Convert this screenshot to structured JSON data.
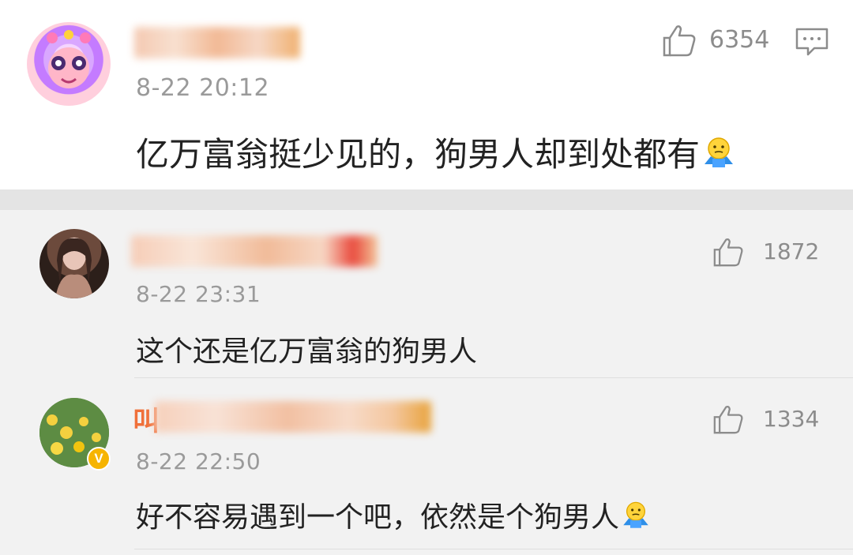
{
  "comments": [
    {
      "timestamp": "8-22 20:12",
      "likes": "6354",
      "text": "亿万富翁挺少见的，狗男人却到处都有",
      "emoji": "shrug-emoji"
    },
    {
      "timestamp": "8-22 23:31",
      "likes": "1872",
      "text": "这个还是亿万富翁的狗男人"
    },
    {
      "timestamp": "8-22 22:50",
      "likes": "1334",
      "text": "好不容易遇到一个吧，依然是个狗男人",
      "emoji": "shrug-emoji",
      "name_visible_prefix": "叫",
      "verified_badge": "V"
    }
  ],
  "colors": {
    "background": "#f2f2f2",
    "main_background": "#ffffff",
    "muted_text": "#9a9a9a",
    "verified_badge": "#f6b400"
  }
}
